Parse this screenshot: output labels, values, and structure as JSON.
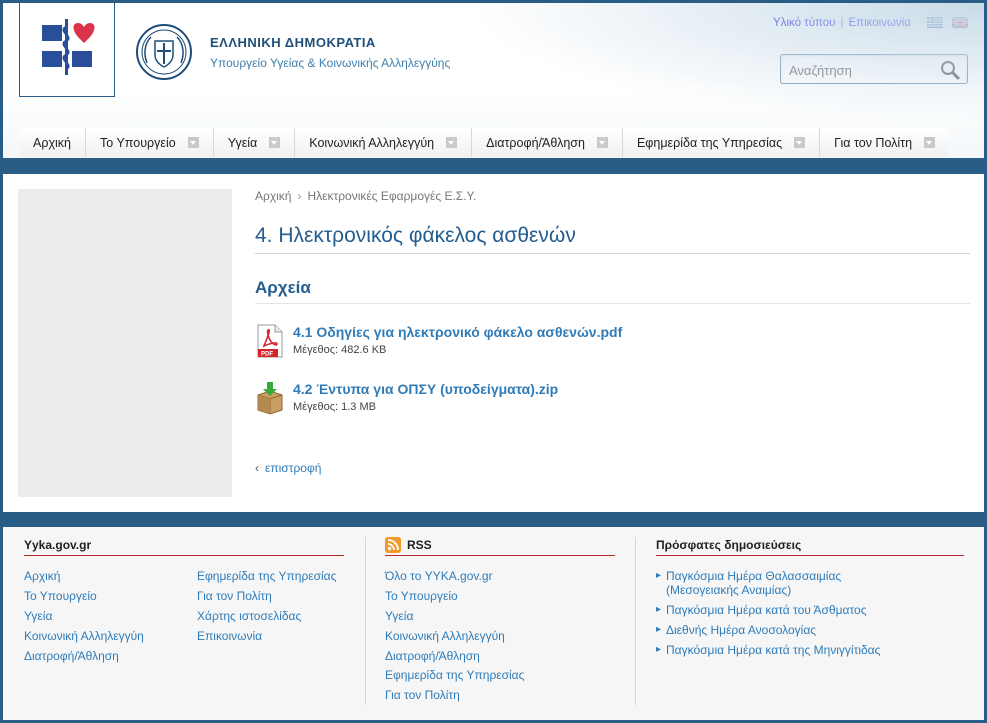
{
  "header": {
    "gov_title": "ΕΛΛΗΝΙΚΗ ΔΗΜΟΚΡΑΤΙΑ",
    "gov_subtitle": "Υπουργείο Υγείας & Κοινωνικής Αλληλεγγύης",
    "top_links": [
      "Υλικό τύπου",
      "Επικοινωνία"
    ],
    "search_placeholder": "Αναζήτηση"
  },
  "nav": {
    "items": [
      {
        "label": "Αρχική",
        "has_dropdown": false
      },
      {
        "label": "Το Υπουργείο",
        "has_dropdown": true
      },
      {
        "label": "Υγεία",
        "has_dropdown": true
      },
      {
        "label": "Κοινωνική Αλληλεγγύη",
        "has_dropdown": true
      },
      {
        "label": "Διατροφή/Άθληση",
        "has_dropdown": true
      },
      {
        "label": "Εφημερίδα της Υπηρεσίας",
        "has_dropdown": true
      },
      {
        "label": "Για τον Πολίτη",
        "has_dropdown": true
      }
    ]
  },
  "breadcrumb": {
    "home": "Αρχική",
    "current": "Ηλεκτρονικές Εφαρμογές Ε.Σ.Υ."
  },
  "main": {
    "title": "4. Ηλεκτρονικός φάκελος ασθενών",
    "section_title": "Αρχεία",
    "files": [
      {
        "name": "4.1 Οδηγίες για ηλεκτρονικό φάκελο ασθενών.pdf",
        "size": "Μέγεθος: 482.6 KB",
        "icon": "pdf-file-icon"
      },
      {
        "name": "4.2 Έντυπα για ΟΠΣΥ (υποδείγματα).zip",
        "size": "Μέγεθος: 1.3 MB",
        "icon": "zip-archive-icon"
      }
    ],
    "back_label": "επιστροφή"
  },
  "footer": {
    "site": {
      "title": "Yyka.gov.gr",
      "col1": [
        "Αρχική",
        "Το Υπουργείο",
        "Υγεία",
        "Κοινωνική Αλληλεγγύη",
        "Διατροφή/Άθληση"
      ],
      "col2": [
        "Εφημερίδα της Υπηρεσίας",
        "Για τον Πολίτη",
        "Χάρτης ιστοσελίδας",
        "Επικοινωνία"
      ]
    },
    "rss": {
      "title": "RSS",
      "links": [
        "Όλο το YYKA.gov.gr",
        "Το Υπουργείο",
        "Υγεία",
        "Κοινωνική Αλληλεγγύη",
        "Διατροφή/Άθληση",
        "Εφημερίδα της Υπηρεσίας",
        "Για τον Πολίτη"
      ]
    },
    "recent": {
      "title": "Πρόσφατες δημοσιεύσεις",
      "items": [
        "Παγκόσμια Ημέρα Θαλασσαιμίας (Μεσογειακής Αναιμίας)",
        "Παγκόσμια Ημέρα κατά του Άσθματος",
        "Διεθνής Ημέρα Ανοσολογίας",
        "Παγκόσμια Ημέρα κατά της Μηνιγγίτιδας"
      ]
    }
  },
  "colors": {
    "background": "#2a5d86",
    "link": "#2f7cb9",
    "title": "#245d8f",
    "footer_rule": "#b22c2c"
  }
}
